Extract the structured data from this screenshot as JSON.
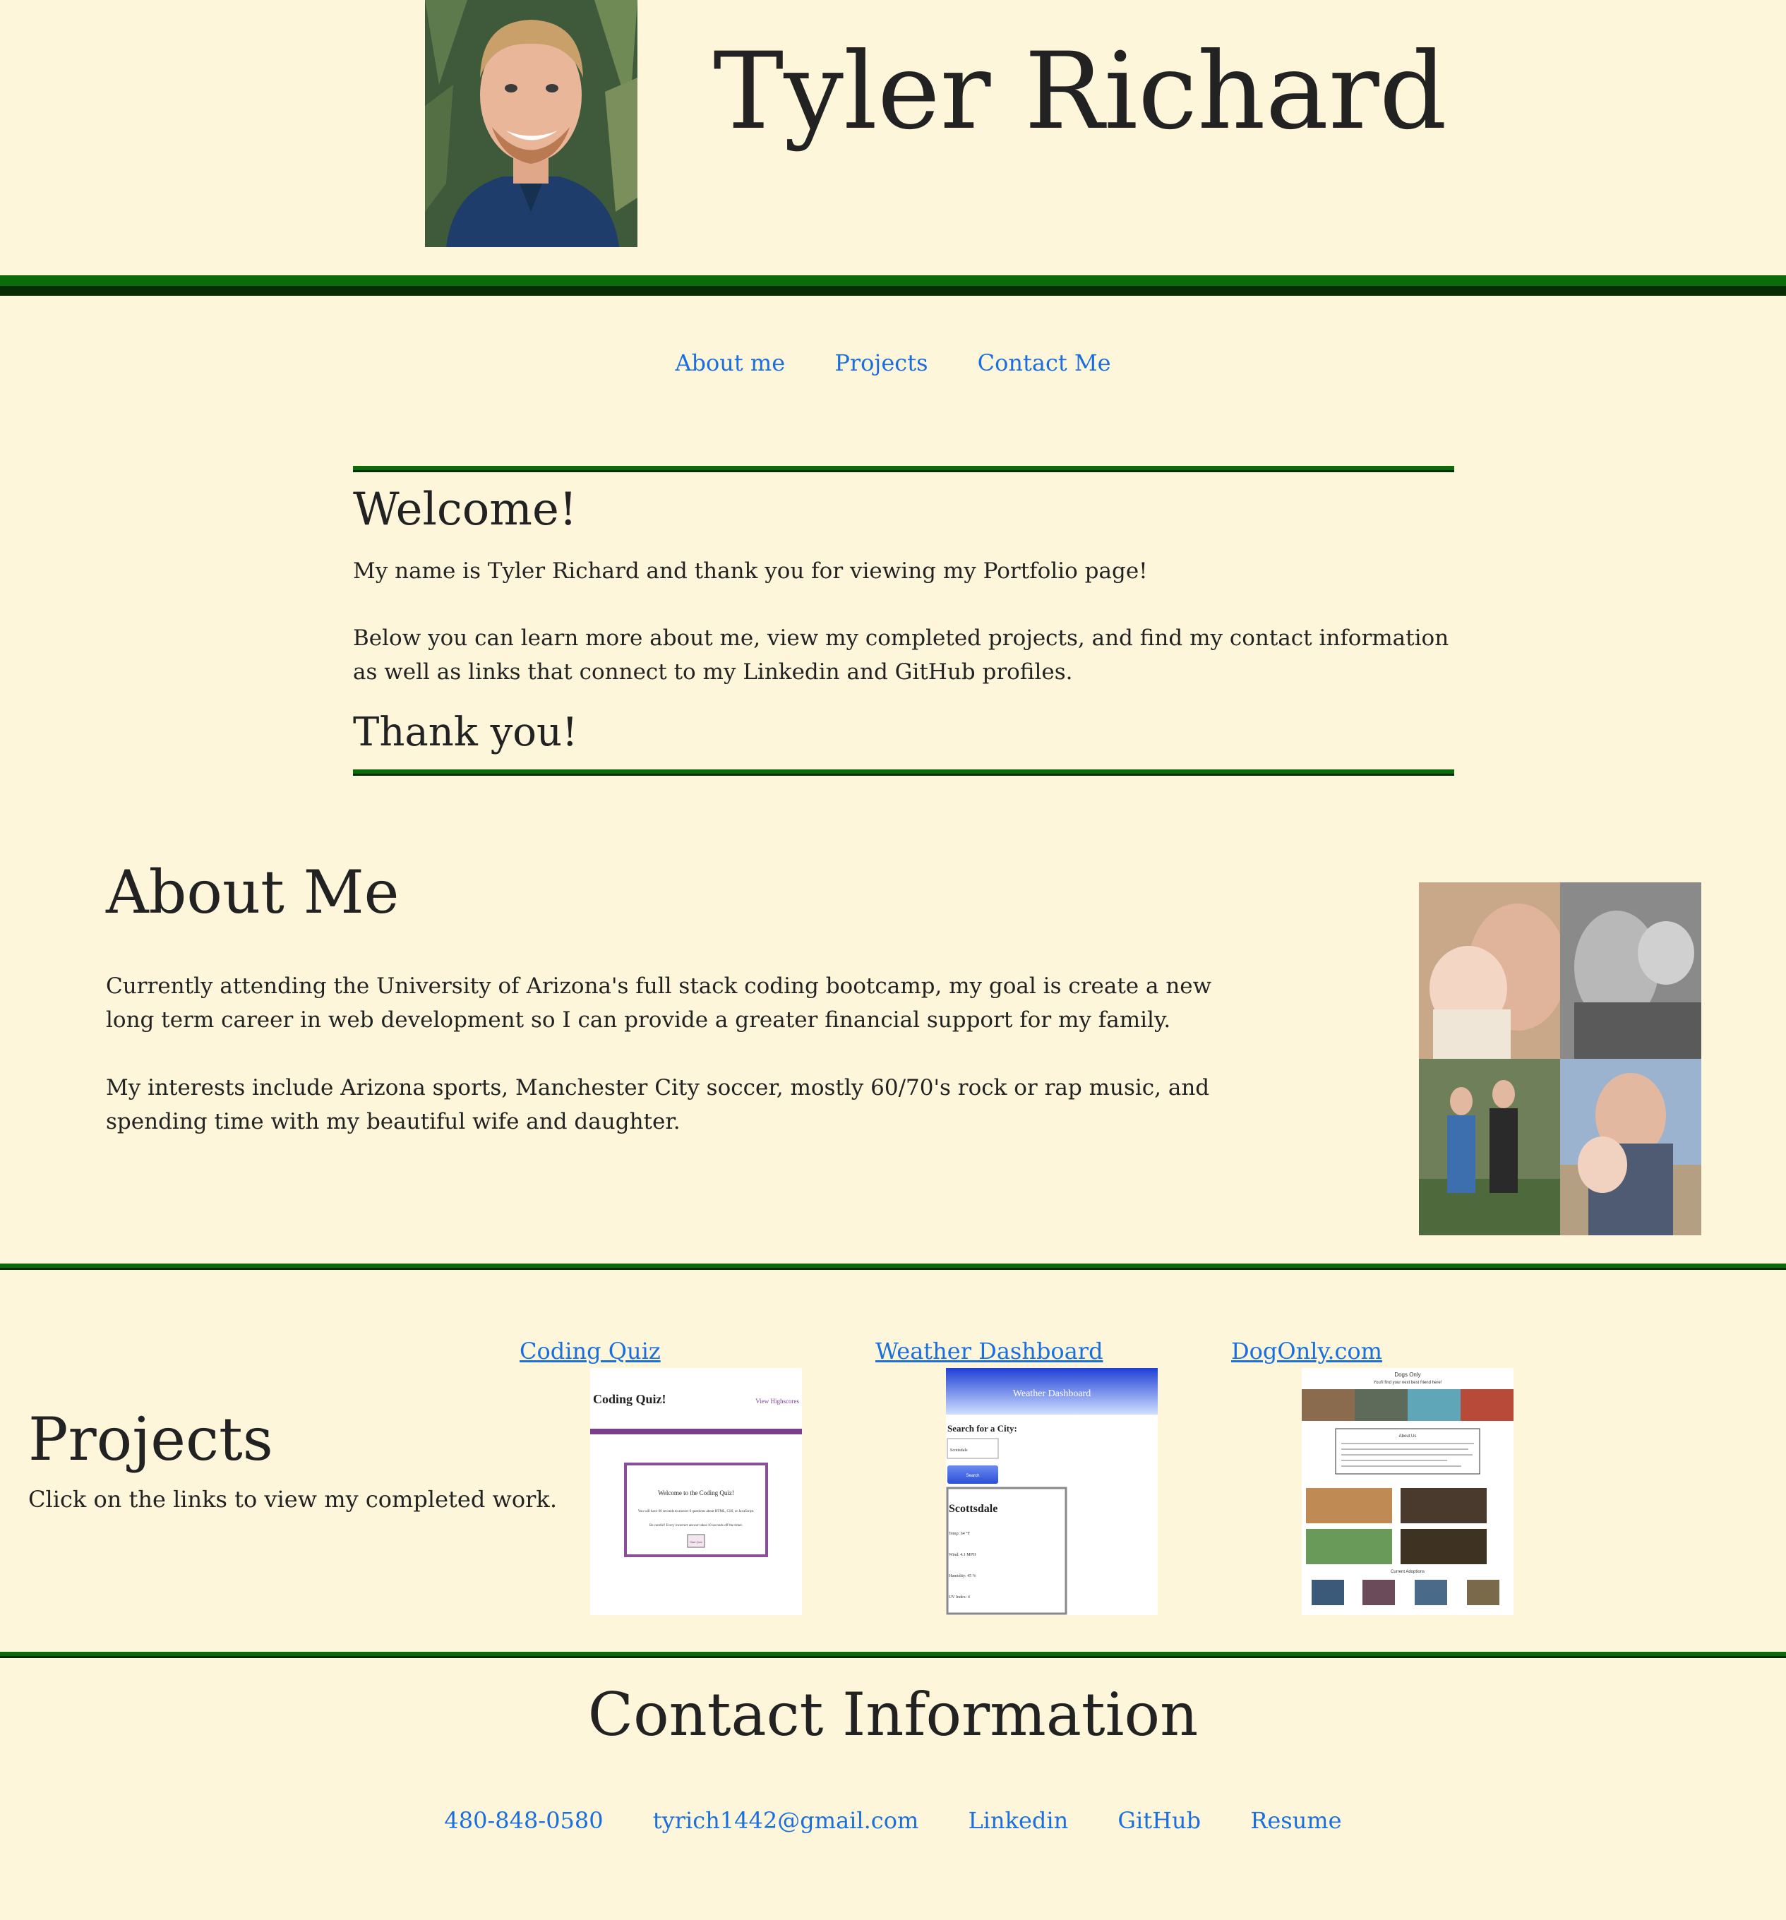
{
  "header": {
    "title": "Tyler Richard"
  },
  "nav": {
    "about": "About me",
    "projects": "Projects",
    "contact": "Contact Me"
  },
  "welcome": {
    "title": "Welcome!",
    "p1": "My name is Tyler Richard and thank you for viewing my Portfolio page!",
    "p2": "Below you can learn more about me, view my completed projects, and find my contact information as well as links that connect to my Linkedin and GitHub profiles.",
    "thanks": "Thank you!"
  },
  "about": {
    "title": "About Me",
    "p1": "Currently attending the University of Arizona's full stack coding bootcamp, my goal is create a new long term career in web development so I can provide a greater financial support for my family.",
    "p2": "My interests include Arizona sports, Manchester City soccer, mostly 60/70's rock or rap music, and spending time with my beautiful wife and daughter."
  },
  "projects": {
    "title": "Projects",
    "subtitle": "Click on the links to view my completed work.",
    "items": [
      {
        "label": "Coding Quiz",
        "thumb": {
          "title": "Coding Quiz!",
          "corner": "View Highscores",
          "welcome": "Welcome to the Coding Quiz!",
          "line": "You will have 60 seconds to answer 6 questions about HTML, CSS, or JavaScript.",
          "quote": "Be careful! Every incorrect answer takes 10 seconds off the timer.",
          "button": "Start Quiz"
        }
      },
      {
        "label": "Weather Dashboard",
        "thumb": {
          "title": "Weather Dashboard",
          "search_label": "Search for a City:",
          "input": "Scottsdale",
          "button": "Search",
          "city": "Scottsdale",
          "rows": [
            "Temp: 64 °F",
            "Wind: 4.1 MPH",
            "Humidity: 45 %",
            "UV Index: 4"
          ]
        }
      },
      {
        "label": "DogOnly.com",
        "thumb": {
          "title": "Dogs Only",
          "tagline": "You'll find your next best friend here!",
          "box_title": "About Us",
          "section": "Current Adoptions"
        }
      }
    ]
  },
  "contact": {
    "title": "Contact Information",
    "phone": "480-848-0580",
    "email": "tyrich1442@gmail.com",
    "linkedin": "Linkedin",
    "github": "GitHub",
    "resume": "Resume"
  },
  "colors": {
    "background": "#fdf6da",
    "rule_green": "#0b6b0b",
    "rule_dark": "#052d05",
    "link": "#1a6fe0",
    "text": "#222222"
  }
}
